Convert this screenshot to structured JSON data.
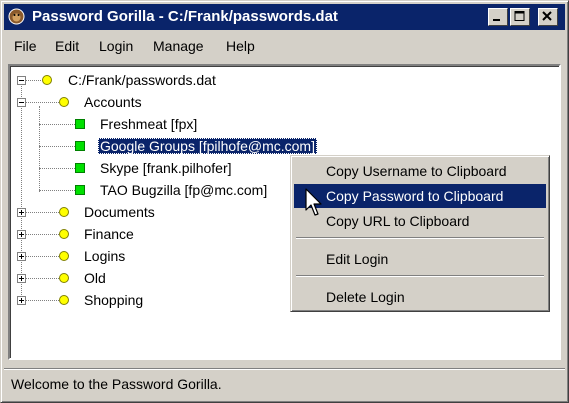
{
  "window": {
    "title": "Password Gorilla - C:/Frank/passwords.dat"
  },
  "titlebar": {
    "min_icon": "minimize-icon",
    "max_icon": "maximize-icon",
    "close_icon": "close-icon"
  },
  "menubar": {
    "items": [
      "File",
      "Edit",
      "Login",
      "Manage",
      "Help"
    ]
  },
  "tree": {
    "root": "C:/Frank/passwords.dat",
    "groups": [
      {
        "label": "Accounts",
        "expanded": true,
        "logins": [
          {
            "label": "Freshmeat [fpx]"
          },
          {
            "label": "Google Groups [fpilhofe@mc.com]",
            "selected": true
          },
          {
            "label": "Skype [frank.pilhofer]"
          },
          {
            "label": "TAO Bugzilla [fp@mc.com]"
          }
        ]
      },
      {
        "label": "Documents",
        "expanded": false
      },
      {
        "label": "Finance",
        "expanded": false
      },
      {
        "label": "Logins",
        "expanded": false
      },
      {
        "label": "Old",
        "expanded": false
      },
      {
        "label": "Shopping",
        "expanded": false
      }
    ]
  },
  "context_menu": {
    "items": [
      {
        "label": "Copy Username to Clipboard"
      },
      {
        "label": "Copy Password to Clipboard",
        "highlighted": true
      },
      {
        "label": "Copy URL to Clipboard"
      },
      {
        "label": "Edit Login"
      },
      {
        "label": "Delete Login"
      }
    ]
  },
  "status": {
    "text": "Welcome to the Password Gorilla."
  },
  "colors": {
    "titlebar": "#0a246a",
    "selection": "#0a246a",
    "group_icon": "#ffff00",
    "login_icon": "#00e000",
    "face": "#d4d0c8"
  }
}
